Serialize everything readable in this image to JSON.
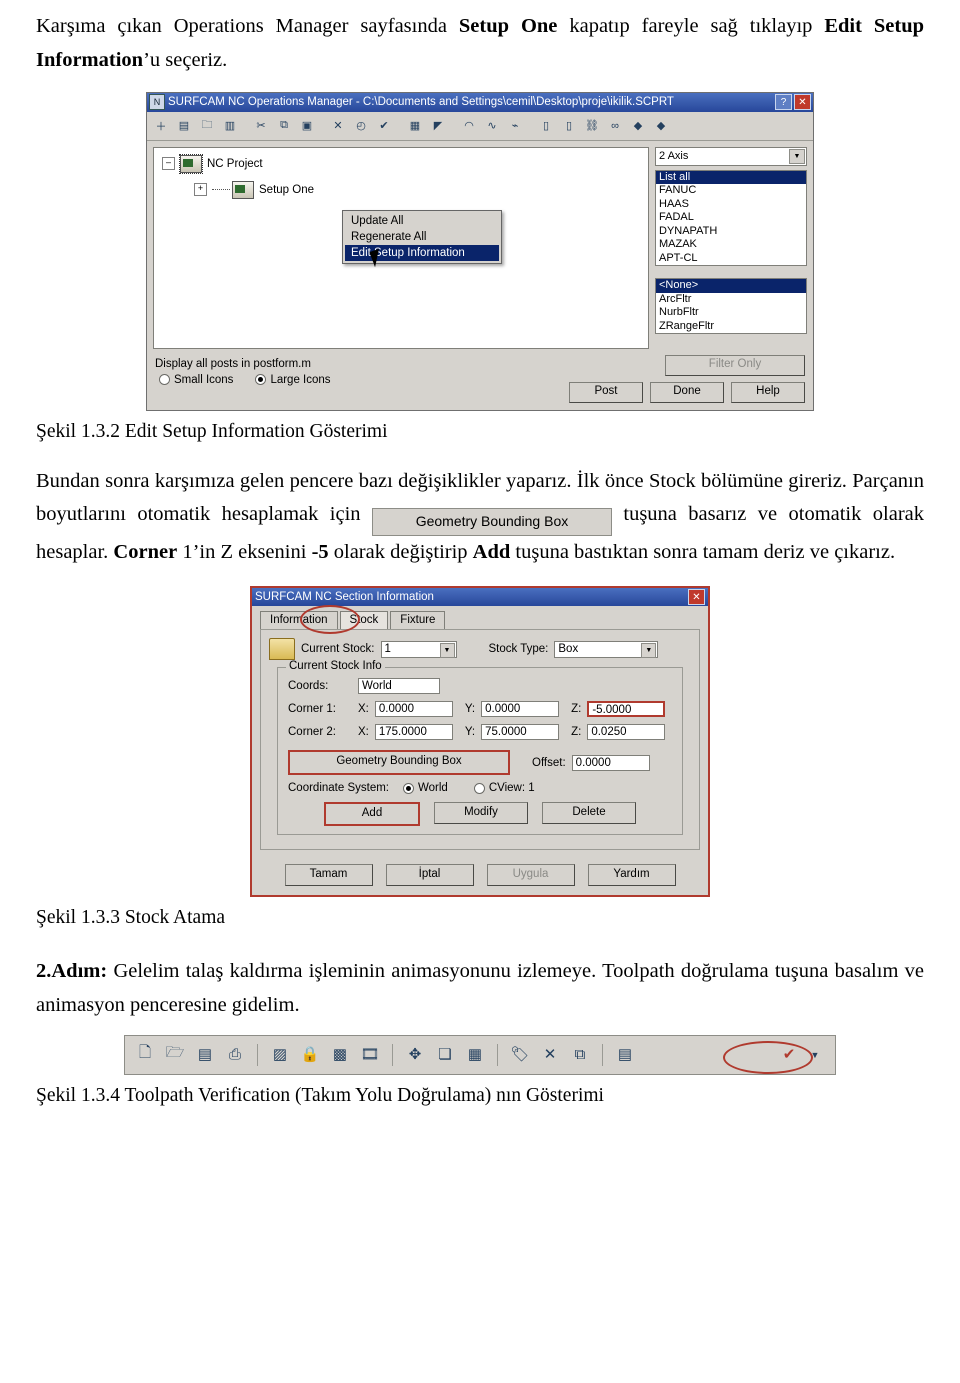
{
  "document": {
    "para1_pre": "Karşıma çıkan Operations Manager sayfasında ",
    "para1_b1": "Setup One",
    "para1_mid": " kapatıp fareyle sağ tıklayıp ",
    "para1_b2": "Edit Setup Information",
    "para1_post": "’u seçeriz.",
    "caption1": "Şekil 1.3.2 Edit Setup Information Gösterimi",
    "para2_a": "Bundan sonra karşımıza gelen pencere bazı değişiklikler yaparız. İlk önce Stock bölümüne gireriz. Parçanın boyutlarını otomatik hesaplamak için",
    "para2_b": "tuşuna basarız ve otomatik olarak hesaplar. ",
    "para2_corner": "Corner",
    "para2_c": " 1’in Z eksenini ",
    "para2_minus5": "-5",
    "para2_d": " olarak değiştirip ",
    "para2_add": "Add",
    "para2_e": " tuşuna bastıktan sonra tamam deriz ve çıkarız.",
    "caption2": "Şekil 1.3.3 Stock Atama",
    "para3_step": "2.Adım:",
    "para3_a": " Gelelim talaş kaldırma işleminin animasyonunu izlemeye. Toolpath doğrulama tuşuna basalım ve animasyon penceresine gidelim.",
    "caption3": "Şekil 1.3.4 Toolpath Verification (Takım Yolu Doğrulama) nın Gösterimi",
    "inline_button_label": "Geometry Bounding Box"
  },
  "shot1": {
    "title": "SURFCAM NC Operations Manager - C:\\Documents and Settings\\cemil\\Desktop\\proje\\ikilik.SCPRT",
    "titlebar_icon": "nc-manager-icon",
    "help_btn": "?",
    "close_btn": "✕",
    "tree": {
      "root_label": "NC Project",
      "child_label": "Setup One",
      "expander_root": "–",
      "expander_child": "+"
    },
    "context_menu": [
      "Update All",
      "Regenerate All",
      "Edit Setup Information"
    ],
    "context_menu_selected": "Edit Setup Information",
    "axis_combo": "2 Axis",
    "post_list": [
      "List all",
      "FANUC",
      "HAAS",
      "FADAL",
      "DYNAPATH",
      "MAZAK",
      "APT-CL"
    ],
    "post_list_selected": "List all",
    "filter_list": [
      "<None>",
      "ArcFltr",
      "NurbFltr",
      "ZRangeFltr"
    ],
    "filter_list_selected": "<None>",
    "status_text": "Display all posts in postform.m",
    "radio_small": "Small Icons",
    "radio_large": "Large Icons",
    "radio_selected": "Large Icons",
    "filter_only_btn": "Filter Only",
    "buttons": [
      "Post",
      "Done",
      "Help"
    ]
  },
  "shot2": {
    "title": "SURFCAM NC Section Information",
    "close_btn": "✕",
    "tabs": [
      "Information",
      "Stock",
      "Fixture"
    ],
    "active_tab": "Stock",
    "folder_icon": "folder-icon",
    "current_stock_label": "Current Stock:",
    "current_stock_value": "1",
    "stock_type_label": "Stock Type:",
    "stock_type_value": "Box",
    "group_title": "Current Stock Info",
    "coords_label": "Coords:",
    "coords_value": "World",
    "corner1_label": "Corner 1:",
    "corner1": {
      "x_label": "X:",
      "x": "0.0000",
      "y_label": "Y:",
      "y": "0.0000",
      "z_label": "Z:",
      "z": "-5.0000"
    },
    "corner2_label": "Corner 2:",
    "corner2": {
      "x_label": "X:",
      "x": "175.0000",
      "y_label": "Y:",
      "y": "75.0000",
      "z_label": "Z:",
      "z": "0.0250"
    },
    "gbb_button": "Geometry Bounding Box",
    "offset_label": "Offset:",
    "offset_value": "0.0000",
    "coordsys_label": "Coordinate System:",
    "coordsys_world": "World",
    "coordsys_cview": "CView: 1",
    "coordsys_selected": "World",
    "action_buttons": [
      "Add",
      "Modify",
      "Delete"
    ],
    "action_highlighted": "Add",
    "footer_buttons": [
      "Tamam",
      "İptal",
      "Uygula",
      "Yardım"
    ],
    "footer_disabled": "Uygula"
  },
  "shot3": {
    "icons": [
      "new-file-icon",
      "open-folder-icon",
      "save-icon",
      "print-icon",
      "sep",
      "post-icon",
      "lock-icon",
      "export-icon",
      "film-icon",
      "sep",
      "move-icon",
      "window-icon",
      "layout-icon",
      "sep",
      "tag-icon",
      "delete-x-icon",
      "copy-icon",
      "sep",
      "table-icon",
      "verify-check-icon",
      "dropdown-arrow-icon"
    ],
    "highlight_name": "toolpath-verification-button"
  },
  "colors": {
    "accent_red": "#b03a2e",
    "title_blue": "#27479a",
    "window_gray": "#d6d3ce",
    "select_blue": "#0a246a"
  }
}
